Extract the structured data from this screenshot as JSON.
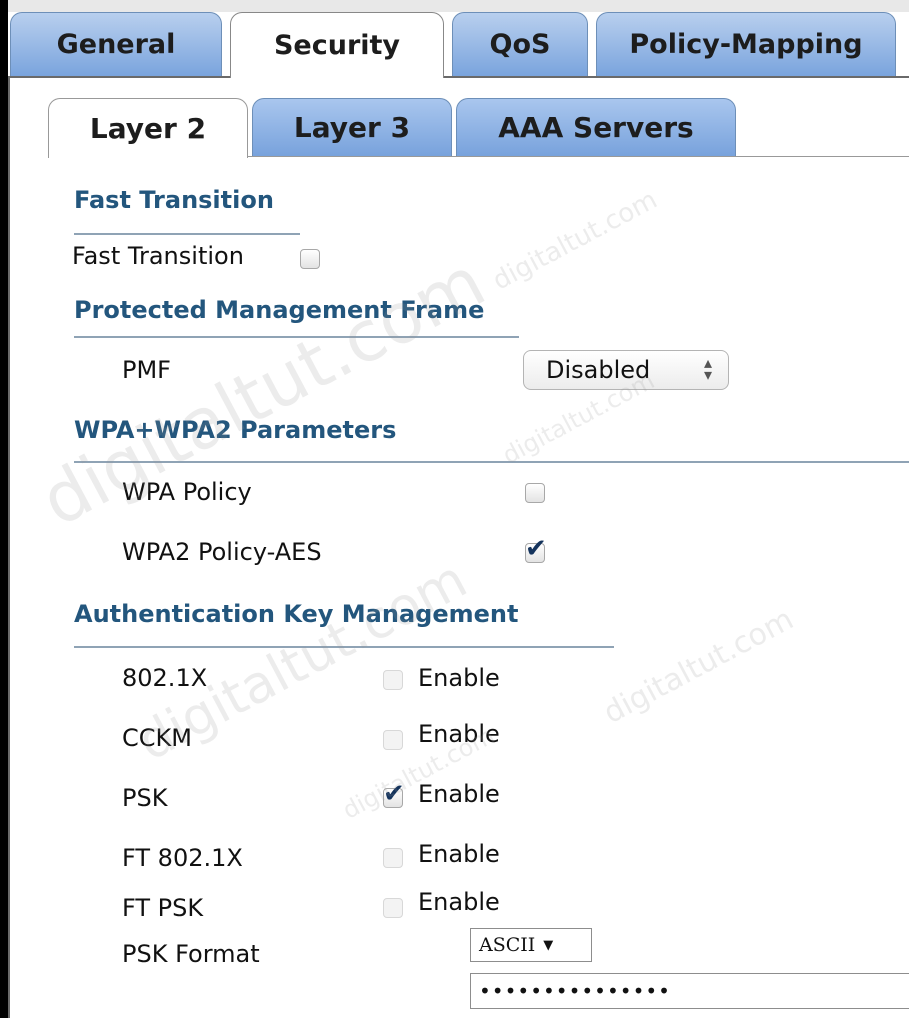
{
  "tabs": [
    {
      "label": "General"
    },
    {
      "label": "Security",
      "active": true
    },
    {
      "label": "QoS"
    },
    {
      "label": "Policy-Mapping"
    }
  ],
  "subtabs": [
    {
      "label": "Layer 2",
      "active": true
    },
    {
      "label": "Layer 3"
    },
    {
      "label": "AAA Servers"
    }
  ],
  "fast_transition": {
    "section_title": "Fast Transition",
    "label": "Fast Transition",
    "checked": false
  },
  "pmf": {
    "section_title": "Protected Management Frame",
    "label": "PMF",
    "selected": "Disabled"
  },
  "wpa": {
    "section_title": "WPA+WPA2 Parameters",
    "policy_label": "WPA Policy",
    "policy_checked": false,
    "wpa2_label": "WPA2 Policy-AES",
    "wpa2_checked": true
  },
  "akm": {
    "section_title": "Authentication Key Management",
    "enable_text": "Enable",
    "rows": [
      {
        "label": "802.1X",
        "checked": false
      },
      {
        "label": "CCKM",
        "checked": false
      },
      {
        "label": "PSK",
        "checked": true
      },
      {
        "label": "FT 802.1X",
        "checked": false
      },
      {
        "label": "FT PSK",
        "checked": false
      }
    ],
    "psk_format_label": "PSK Format",
    "psk_format_value": "ASCII",
    "psk_value": "•••••••••••••••"
  },
  "watermark": "digitaltut.com",
  "colors": {
    "tab_blue": "#7aa4dd",
    "section_text": "#23567d",
    "check": "#14335c"
  }
}
